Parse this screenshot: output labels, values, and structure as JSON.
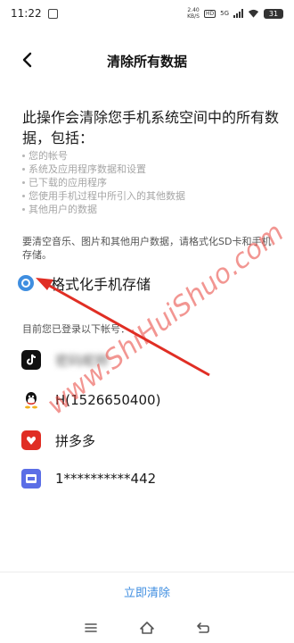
{
  "status": {
    "time": "11:22",
    "net_speed_value": "2.40",
    "net_speed_unit": "KB/S",
    "hd": "HD",
    "network": "5G",
    "battery": "31"
  },
  "header": {
    "title": "清除所有数据"
  },
  "intro": "此操作会清除您手机系统空间中的所有数据，包括：",
  "items": [
    {
      "label": "您的帐号"
    },
    {
      "label": "系统及应用程序数据和设置"
    },
    {
      "label": "已下载的应用程序"
    },
    {
      "label": "您使用手机过程中所引入的其他数据"
    },
    {
      "label": "其他用户的数据"
    }
  ],
  "note": "要清空音乐、图片和其他用户数据，请格式化SD卡和手机存储。",
  "option": {
    "label": "格式化手机存储",
    "checked": true
  },
  "accounts_title": "目前您已登录以下帐号：",
  "accounts": [
    {
      "name": "密码昵称",
      "icon": "tiktok-icon"
    },
    {
      "name": "H(1526650400)",
      "icon": "qq-icon"
    },
    {
      "name": "拼多多",
      "icon": "pinduoduo-icon"
    },
    {
      "name": "1**********442",
      "icon": "message-icon"
    }
  ],
  "watermark": "www.ShiHuiShuo.com",
  "actions": {
    "clear_label": "立即清除"
  },
  "colors": {
    "accent": "#3f8ee0",
    "watermark": "#e8423a"
  }
}
